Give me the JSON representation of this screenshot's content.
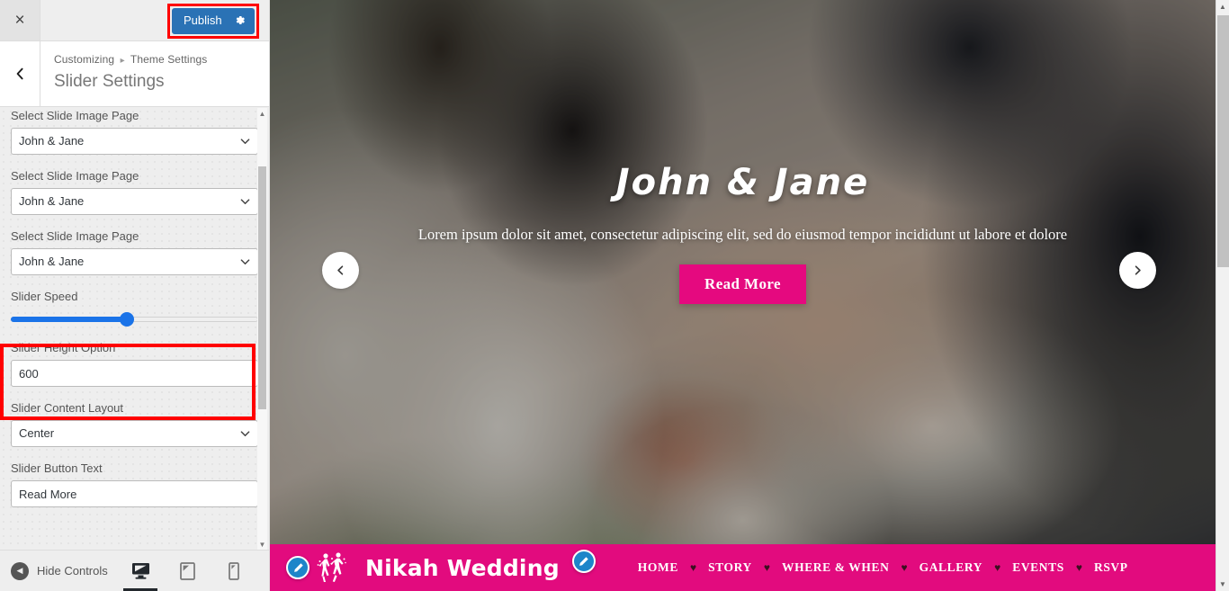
{
  "customizer": {
    "close_label": "×",
    "close_icon": "close-icon",
    "publish_label": "Publish",
    "publish_gear_icon": "gear-icon",
    "back_icon": "chevron-left-icon",
    "breadcrumb_root": "Customizing",
    "breadcrumb_sep": "▸",
    "breadcrumb_parent": "Theme Settings",
    "panel_title": "Slider Settings",
    "highlight_color": "#ff0000",
    "publish_bg": "#2a72b5"
  },
  "controls": [
    {
      "label": "Select Slide Image Page",
      "type": "select",
      "value": "John & Jane"
    },
    {
      "label": "Select Slide Image Page",
      "type": "select",
      "value": "John & Jane"
    },
    {
      "label": "Select Slide Image Page",
      "type": "select",
      "value": "John & Jane"
    },
    {
      "label": "Slider Speed",
      "type": "range",
      "value": 47
    },
    {
      "label": "Slider Height Option",
      "type": "text",
      "value": "600"
    },
    {
      "label": "Slider Content Layout",
      "type": "select",
      "value": "Center"
    },
    {
      "label": "Slider Button Text",
      "type": "text",
      "value": "Read More"
    }
  ],
  "footer": {
    "hide_controls_label": "Hide Controls",
    "hide_controls_icon": "collapse-left-icon",
    "devices": [
      {
        "name": "desktop",
        "icon": "desktop-icon",
        "active": true
      },
      {
        "name": "tablet",
        "icon": "tablet-icon",
        "active": false
      },
      {
        "name": "mobile",
        "icon": "mobile-icon",
        "active": false
      }
    ]
  },
  "preview": {
    "slide": {
      "title": "John & Jane",
      "description": "Lorem ipsum dolor sit amet, consectetur adipiscing elit, sed do eiusmod tempor incididunt ut labore et dolore",
      "button_label": "Read More",
      "button_color": "#e5097f",
      "prev_icon": "chevron-left-icon",
      "next_icon": "chevron-right-icon"
    },
    "site_bar": {
      "bg_color": "#e20b7e",
      "brand_name": "Nikah Wedding",
      "brand_icon": "dancing-couple-icon",
      "edit_icon": "pencil-edit-icon",
      "edit_icon_color": "#1d85c9",
      "separator_icon": "heart-icon",
      "nav": [
        "HOME",
        "STORY",
        "WHERE & WHEN",
        "GALLERY",
        "EVENTS",
        "RSVP"
      ]
    }
  }
}
